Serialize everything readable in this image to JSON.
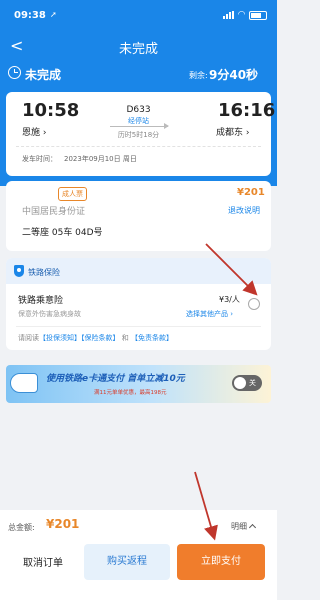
{
  "status_bar": {
    "time": "09:38",
    "location_arrow": "➚"
  },
  "nav": {
    "back_glyph": "<",
    "title": "未完成"
  },
  "order": {
    "status": "未完成",
    "remaining_label": "剩余:",
    "remaining_time": "9分40秒"
  },
  "train": {
    "departure_time": "10:58",
    "departure_station": "恩施",
    "arrival_time": "16:16",
    "arrival_station": "成都东",
    "train_number": "D633",
    "stopover_link": "经停站",
    "duration": "历时5时18分",
    "departure_label": "发车时间：",
    "departure_date": "2023年09月10日 周日"
  },
  "passenger": {
    "ticket_type": "成人票",
    "price": "¥201",
    "id_type": "中国居民身份证",
    "refund_link": "退改说明",
    "seat": "二等座 05车 04D号"
  },
  "insurance": {
    "section_title": "铁路保险",
    "product_name": "铁路乘意险",
    "price": "¥3/人",
    "description": "保意外伤害急病身故",
    "other_products": "选择其他产品",
    "terms_prefix": "请阅读",
    "terms_links": [
      "【投保须知】",
      "【保险条款】",
      "【免责条款】"
    ],
    "terms_and": "和"
  },
  "ad": {
    "headline": "使用铁路e卡通支付 首单立减10元",
    "subline": "满11元单单优惠，最高198元",
    "toggle_label": "关"
  },
  "bottom": {
    "total_label": "总金额:",
    "total_amount": "¥201",
    "detail_link": "明细",
    "cancel_label": "取消订单",
    "return_label": "购买返程",
    "pay_label": "立即支付"
  },
  "colors": {
    "primary": "#1a86e8",
    "accent": "#f07d2c",
    "price": "#e8872a",
    "annotation": "#c0362c"
  }
}
